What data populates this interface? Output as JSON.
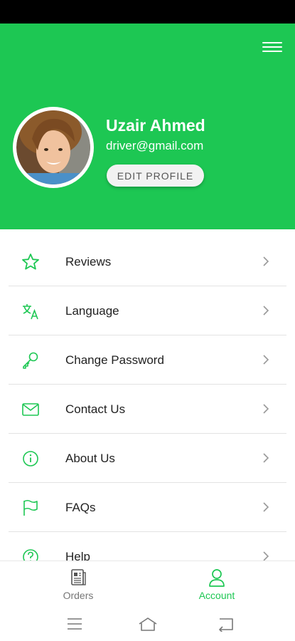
{
  "profile": {
    "name": "Uzair Ahmed",
    "email": "driver@gmail.com",
    "edit_label": "EDIT PROFILE"
  },
  "menu": [
    {
      "label": "Reviews",
      "icon": "star-icon"
    },
    {
      "label": "Language",
      "icon": "translate-icon"
    },
    {
      "label": "Change Password",
      "icon": "key-icon"
    },
    {
      "label": "Contact Us",
      "icon": "envelope-icon"
    },
    {
      "label": "About Us",
      "icon": "info-icon"
    },
    {
      "label": "FAQs",
      "icon": "flag-icon"
    },
    {
      "label": "Help",
      "icon": "question-icon"
    }
  ],
  "bottom_nav": {
    "orders_label": "Orders",
    "account_label": "Account",
    "active": "Account"
  },
  "colors": {
    "accent": "#1DC753",
    "status_bar": "#000000",
    "inactive": "#777777"
  }
}
